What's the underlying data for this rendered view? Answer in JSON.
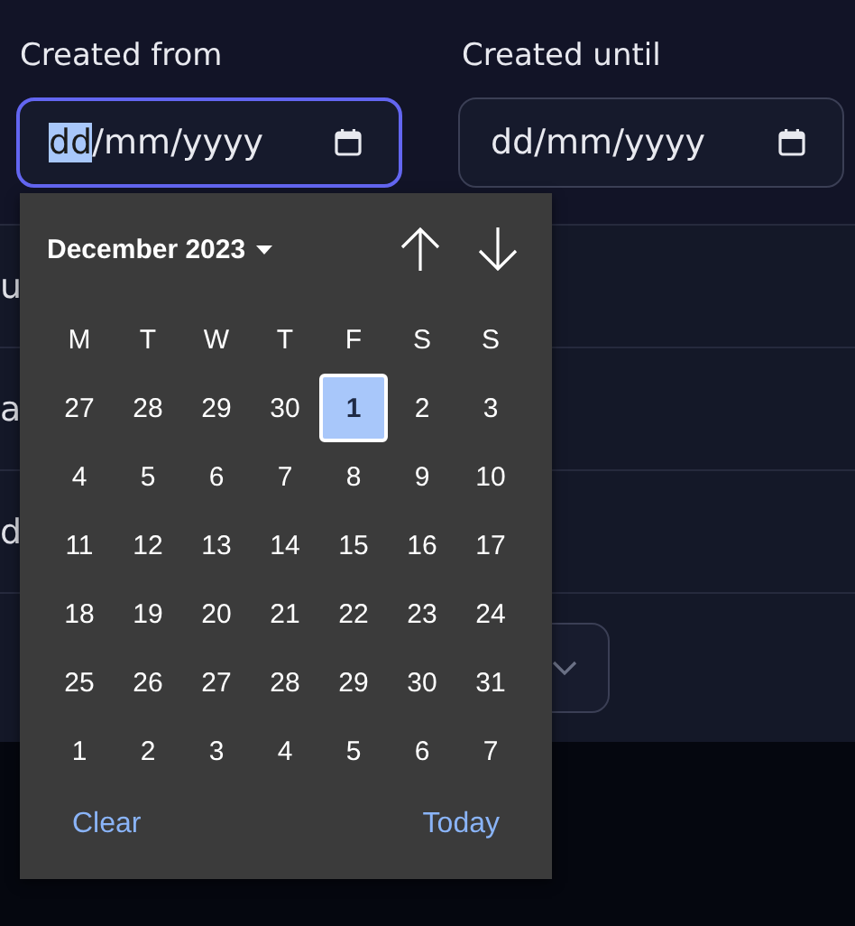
{
  "filters": [
    {
      "label": "Created from",
      "focused": true,
      "segments": [
        {
          "text": "dd",
          "selected": true
        },
        {
          "text": "/",
          "selected": false
        },
        {
          "text": "mm",
          "selected": false
        },
        {
          "text": "/",
          "selected": false
        },
        {
          "text": "yyyy",
          "selected": false
        }
      ]
    },
    {
      "label": "Created until",
      "focused": false,
      "segments": [
        {
          "text": "dd",
          "selected": false
        },
        {
          "text": "/",
          "selected": false
        },
        {
          "text": "mm",
          "selected": false
        },
        {
          "text": "/",
          "selected": false
        },
        {
          "text": "yyyy",
          "selected": false
        }
      ]
    }
  ],
  "panel": {
    "rows": [
      {
        "kind": "text",
        "text": "u"
      },
      {
        "kind": "text",
        "text": "a"
      },
      {
        "kind": "text",
        "text": "d"
      },
      {
        "kind": "select"
      }
    ]
  },
  "calendar": {
    "month": "December 2023",
    "weekdays": [
      "M",
      "T",
      "W",
      "T",
      "F",
      "S",
      "S"
    ],
    "weeks": [
      [
        {
          "day": "27",
          "selected": false
        },
        {
          "day": "28",
          "selected": false
        },
        {
          "day": "29",
          "selected": false
        },
        {
          "day": "30",
          "selected": false
        },
        {
          "day": "1",
          "selected": true
        },
        {
          "day": "2",
          "selected": false
        },
        {
          "day": "3",
          "selected": false
        }
      ],
      [
        {
          "day": "4",
          "selected": false
        },
        {
          "day": "5",
          "selected": false
        },
        {
          "day": "6",
          "selected": false
        },
        {
          "day": "7",
          "selected": false
        },
        {
          "day": "8",
          "selected": false
        },
        {
          "day": "9",
          "selected": false
        },
        {
          "day": "10",
          "selected": false
        }
      ],
      [
        {
          "day": "11",
          "selected": false
        },
        {
          "day": "12",
          "selected": false
        },
        {
          "day": "13",
          "selected": false
        },
        {
          "day": "14",
          "selected": false
        },
        {
          "day": "15",
          "selected": false
        },
        {
          "day": "16",
          "selected": false
        },
        {
          "day": "17",
          "selected": false
        }
      ],
      [
        {
          "day": "18",
          "selected": false
        },
        {
          "day": "19",
          "selected": false
        },
        {
          "day": "20",
          "selected": false
        },
        {
          "day": "21",
          "selected": false
        },
        {
          "day": "22",
          "selected": false
        },
        {
          "day": "23",
          "selected": false
        },
        {
          "day": "24",
          "selected": false
        }
      ],
      [
        {
          "day": "25",
          "selected": false
        },
        {
          "day": "26",
          "selected": false
        },
        {
          "day": "27",
          "selected": false
        },
        {
          "day": "28",
          "selected": false
        },
        {
          "day": "29",
          "selected": false
        },
        {
          "day": "30",
          "selected": false
        },
        {
          "day": "31",
          "selected": false
        }
      ],
      [
        {
          "day": "1",
          "selected": false
        },
        {
          "day": "2",
          "selected": false
        },
        {
          "day": "3",
          "selected": false
        },
        {
          "day": "4",
          "selected": false
        },
        {
          "day": "5",
          "selected": false
        },
        {
          "day": "6",
          "selected": false
        },
        {
          "day": "7",
          "selected": false
        }
      ]
    ],
    "clear": "Clear",
    "today": "Today"
  }
}
